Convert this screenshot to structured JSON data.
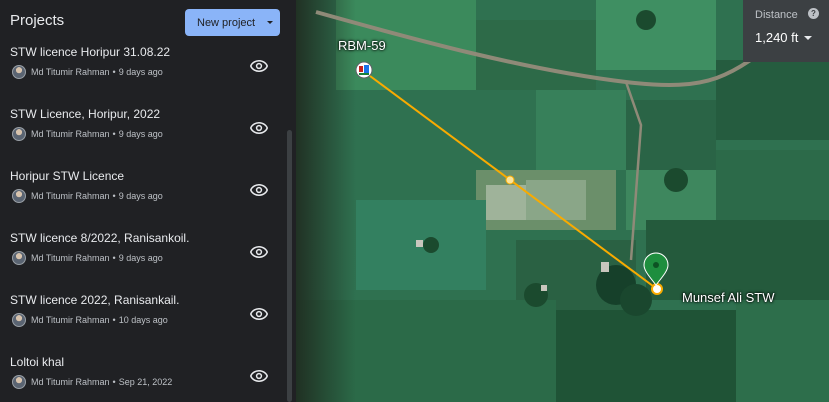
{
  "sidebar": {
    "title": "Projects",
    "new_project_label": "New project",
    "items": [
      {
        "title": "STW licence Horipur 31.08.22",
        "author": "Md Titumir Rahman",
        "time": "9 days ago"
      },
      {
        "title": "STW Licence, Horipur, 2022",
        "author": "Md Titumir Rahman",
        "time": "9 days ago"
      },
      {
        "title": "Horipur STW Licence",
        "author": "Md Titumir Rahman",
        "time": "9 days ago"
      },
      {
        "title": "STW licence 8/2022, Ranisankoil.",
        "author": "Md Titumir Rahman",
        "time": "9 days ago"
      },
      {
        "title": "STW licence 2022, Ranisankail.",
        "author": "Md Titumir Rahman",
        "time": "10 days ago"
      },
      {
        "title": "Loltoi khal",
        "author": "Md Titumir Rahman",
        "time": "Sep 21, 2022"
      }
    ],
    "separator": "•"
  },
  "map": {
    "start_label": "RBM-59",
    "end_label": "Munsef Ali STW",
    "line_color": "#f9ab00",
    "pin_color": "#1e8e3e"
  },
  "distance": {
    "label": "Distance",
    "help": "?",
    "value": "1,240 ft"
  },
  "icons": {
    "project_visibility": "eye-icon",
    "help": "help-icon",
    "dropdown": "caret-down-icon",
    "start_marker": "well-marker-icon",
    "end_marker": "map-pin-icon"
  }
}
